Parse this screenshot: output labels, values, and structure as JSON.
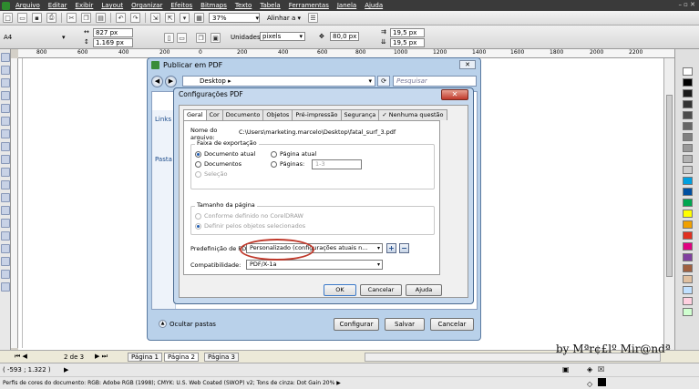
{
  "menubar": {
    "items": [
      "Arquivo",
      "Editar",
      "Exibir",
      "Layout",
      "Organizar",
      "Efeitos",
      "Bitmaps",
      "Texto",
      "Tabela",
      "Ferramentas",
      "Janela",
      "Ajuda"
    ]
  },
  "toolbar1": {
    "zoom": "37%",
    "align": "Alinhar a"
  },
  "toolbar2": {
    "paper": "A4",
    "width": "827 px",
    "height": "1.169 px",
    "units_label": "Unidades:",
    "units_value": "pixels",
    "nudge": "80,0 px",
    "dup_x": "19,5 px",
    "dup_y": "19,5 px"
  },
  "ruler": {
    "ticks": [
      "800",
      "600",
      "400",
      "200",
      "0",
      "200",
      "400",
      "600",
      "800",
      "1000",
      "1200",
      "1400",
      "1600",
      "1800",
      "2000",
      "2200"
    ],
    "unit": "pixels"
  },
  "publish_window": {
    "title": "Publicar em PDF",
    "address": "Desktop",
    "search_placeholder": "Pesquisar",
    "side_links": [
      "Links",
      "Pasta"
    ],
    "hide_folders": "Ocultar pastas",
    "buttons": {
      "configure": "Configurar",
      "save": "Salvar",
      "cancel": "Cancelar"
    }
  },
  "config_dialog": {
    "title": "Configurações PDF",
    "tabs": [
      "Geral",
      "Cor",
      "Documento",
      "Objetos",
      "Pré-impressão",
      "Segurança",
      "Nenhuma questão"
    ],
    "filename_label": "Nome do arquivo:",
    "filename_value": "C:\\Users\\marketing.marcelo\\Desktop\\fatal_surf_3.pdf",
    "export_range": {
      "title": "Faixa de exportação",
      "current_document": "Documento atual",
      "documents": "Documentos",
      "selection": "Seleção",
      "current_page": "Página atual",
      "pages": "Páginas:",
      "pages_value": "1-3"
    },
    "page_size": {
      "title": "Tamanho da página",
      "as_defined": "Conforme definido no CorelDRAW",
      "from_selected": "Definir pelos objetos selecionados"
    },
    "preset_label": "Predefinição de PDF:",
    "preset_value": "Personalizado (configurações atuais n...",
    "compat_label": "Compatibilidade:",
    "compat_value": "PDF/X-1a",
    "buttons": {
      "ok": "OK",
      "cancel": "Cancelar",
      "help": "Ajuda"
    }
  },
  "pages": {
    "counter": "2 de 3",
    "tabs": [
      "Página 1",
      "Página 2",
      "Página 3"
    ],
    "active": "Página 2"
  },
  "status": {
    "coords": "( -593 ; 1.322 )",
    "color_profiles": "Perfis de cores do documento: RGB: Adobe RGB (1998); CMYK: U.S. Web Coated (SWOP) v2; Tons de cinza: Dot Gain 20%"
  },
  "watermark": "by Mªr¢£lº Mir@ndª",
  "colors": {
    "palette": [
      "#ffffff",
      "#000000",
      "#1a1a1a",
      "#333333",
      "#4d4d4d",
      "#666666",
      "#808080",
      "#999999",
      "#b3b3b3",
      "#cccccc",
      "#00a0e0",
      "#0050a0",
      "#00a650",
      "#ffff00",
      "#f0a000",
      "#e03020",
      "#e00080",
      "#8040a0",
      "#a06040",
      "#e0c0a0",
      "#c0e0ff",
      "#ffd0e0",
      "#d0ffd0"
    ],
    "highlight": "#c0392b"
  }
}
